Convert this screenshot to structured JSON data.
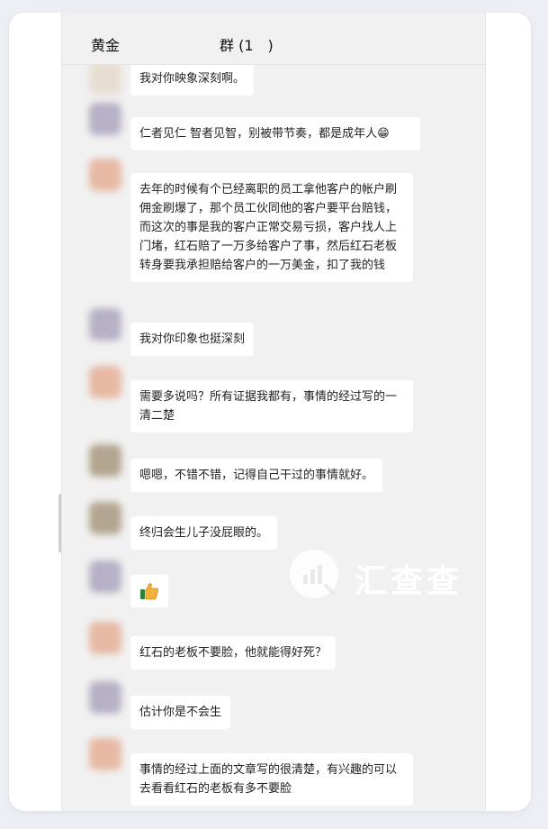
{
  "header": {
    "group_name": "黄金",
    "group_count": "群 (1　)"
  },
  "messages": [
    {
      "avatar": "pale",
      "text": "我对你映象深刻啊。"
    },
    {
      "avatar": "purple",
      "text": "仁者见仁 智者见智，别被带节奏，都是成年人",
      "emoji": "😁"
    },
    {
      "avatar": "peach",
      "text": "去年的时候有个已经离职的员工拿他客户的帐户刷佣金刷爆了，那个员工伙同他的客户要平台赔钱，而这次的事是我的客户正常交易亏损，客户找人上门堵，红石赔了一万多给客户了事，然后红石老板转身要我承担赔给客户的一万美金，扣了我的钱"
    },
    {
      "avatar": "purple",
      "text": "我对你印象也挺深刻"
    },
    {
      "avatar": "peach",
      "text": "需要多说吗？所有证据我都有，事情的经过写的一清二楚"
    },
    {
      "avatar": "brown",
      "text": "嗯嗯，不错不错，记得自己干过的事情就好。"
    },
    {
      "avatar": "brown",
      "text": "终归会生儿子没屁眼的。"
    },
    {
      "avatar": "purple",
      "icon": "thumbs-up-icon"
    },
    {
      "avatar": "peach",
      "text": "红石的老板不要脸，他就能得好死？"
    },
    {
      "avatar": "purple",
      "text": "估计你是不会生"
    },
    {
      "avatar": "peach",
      "text": "事情的经过上面的文章写的很清楚，有兴趣的可以去看看红石的老板有多不要脸"
    }
  ],
  "watermark": {
    "text": "汇查查",
    "icon": "chart-magnifier-icon"
  }
}
